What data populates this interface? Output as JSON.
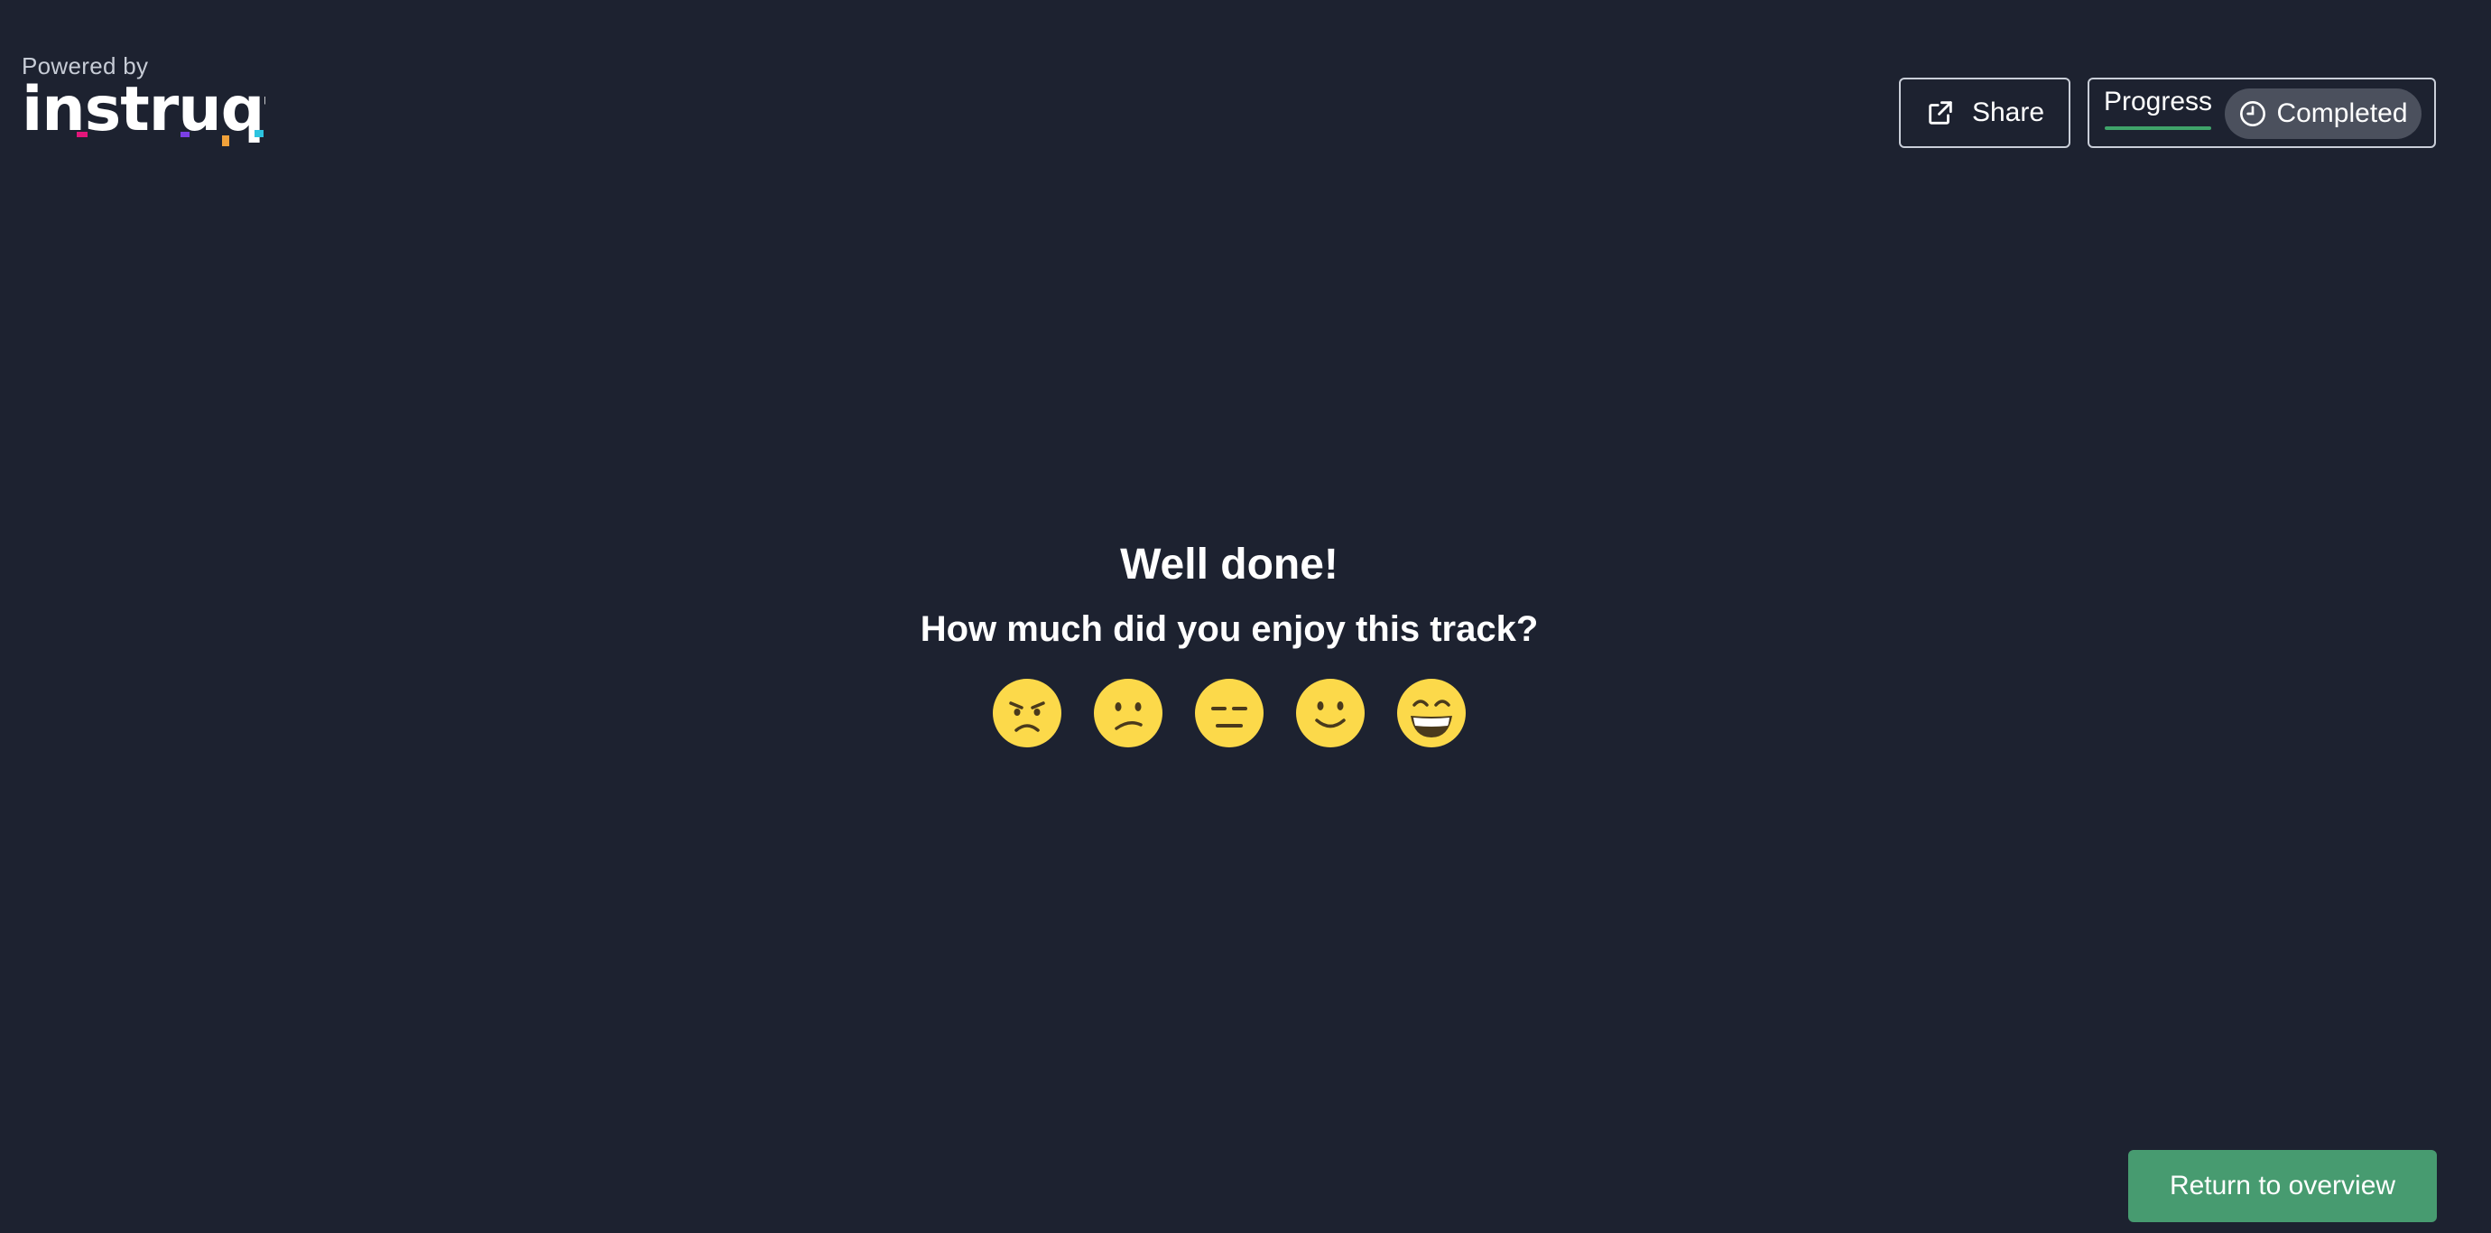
{
  "brand": {
    "powered_by": "Powered by",
    "logo_text": "instruqt",
    "logo_accent_colors": [
      "#e2167a",
      "#7b3fe4",
      "#f0a13a",
      "#2cc4e0"
    ]
  },
  "header": {
    "share_label": "Share",
    "share_icon": "share-icon",
    "progress_label": "Progress",
    "progress_fraction": 1.0,
    "status_label": "Completed",
    "status_icon": "clock-icon"
  },
  "main": {
    "title": "Well done!",
    "question": "How much did you enjoy this track?",
    "ratings": [
      {
        "icon": "angry-face-icon"
      },
      {
        "icon": "confused-face-icon"
      },
      {
        "icon": "expressionless-face-icon"
      },
      {
        "icon": "slightly-smiling-face-icon"
      },
      {
        "icon": "grinning-face-icon"
      }
    ]
  },
  "footer": {
    "return_label": "Return to overview"
  },
  "colors": {
    "background": "#1d2230",
    "accent_green": "#479b70",
    "progress_green": "#3fa46a",
    "pill_gray": "#4b505d",
    "emoji_yellow": "#fcd94a"
  }
}
